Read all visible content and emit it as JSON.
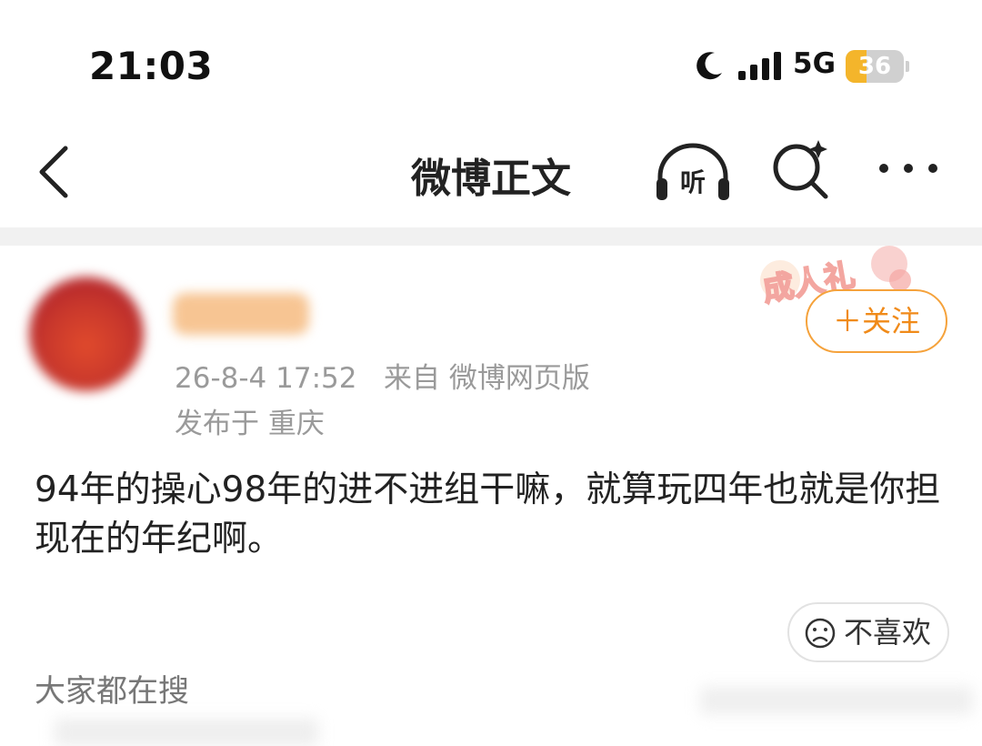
{
  "status_bar": {
    "time": "21:03",
    "network": "5G",
    "battery": "36",
    "battery_level": 0.36,
    "icons": [
      "moon-icon",
      "signal-icon"
    ]
  },
  "nav": {
    "title": "微博正文",
    "back_icon": "chevron-left-icon",
    "listen_label": "听",
    "search_icon": "search-sparkle-icon",
    "more_icon": "more-horizontal-icon"
  },
  "post": {
    "timestamp": "26-8-4 17:52",
    "source": "来自 微博网页版",
    "location": "发布于 重庆",
    "text": "94年的操心98年的进不进组干嘛，就算玩四年也就是你担现在的年纪啊。",
    "campaign_badge": "成人礼",
    "follow_label": "＋关注",
    "dislike_label": "不喜欢"
  },
  "colors": {
    "accent_orange": "#f08a19",
    "follow_border": "#f5a23b",
    "meta_gray": "#9a9a9a",
    "battery_yellow": "#f4b52b"
  },
  "sections": {
    "trending_title": "大家都在搜"
  }
}
